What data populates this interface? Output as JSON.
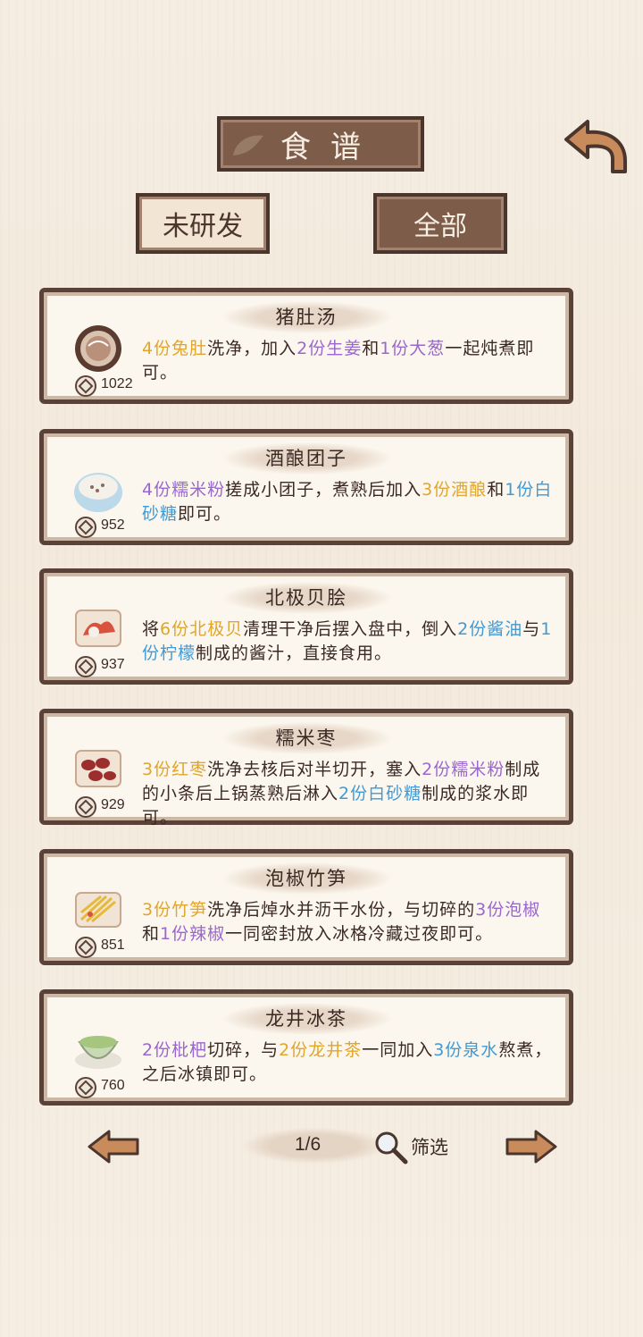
{
  "header": {
    "title": "食谱"
  },
  "tabs": [
    {
      "label": "未研发"
    },
    {
      "label": "全部"
    }
  ],
  "colors": {
    "gold": "#e0a52a",
    "purple": "#9a66cf",
    "blue": "#3f9ad6",
    "text": "#3b2a24",
    "frame": "#5a4239"
  },
  "recipes": [
    {
      "name": "猪肚汤",
      "price": "1022",
      "icon": "pot-soup-icon",
      "desc": [
        {
          "t": "4份兔肚",
          "c": "gold"
        },
        {
          "t": "洗净，加入"
        },
        {
          "t": "2份生姜",
          "c": "purple"
        },
        {
          "t": "和"
        },
        {
          "t": "1份大葱",
          "c": "purple"
        },
        {
          "t": "一起炖煮即可。"
        }
      ]
    },
    {
      "name": "酒酿团子",
      "price": "952",
      "icon": "rice-bowl-icon",
      "desc": [
        {
          "t": "4份糯米粉",
          "c": "purple"
        },
        {
          "t": "搓成小团子，煮熟后加入"
        },
        {
          "t": "3份酒酿",
          "c": "gold"
        },
        {
          "t": "和"
        },
        {
          "t": "1份白砂糖",
          "c": "blue"
        },
        {
          "t": "即可。"
        }
      ]
    },
    {
      "name": "北极贝脍",
      "price": "937",
      "icon": "shellfish-plate-icon",
      "desc": [
        {
          "t": "将"
        },
        {
          "t": "6份北极贝",
          "c": "gold"
        },
        {
          "t": "清理干净后摆入盘中，倒入"
        },
        {
          "t": "2份酱油",
          "c": "blue"
        },
        {
          "t": "与"
        },
        {
          "t": "1份柠檬",
          "c": "blue"
        },
        {
          "t": "制成的酱汁，直接食用。"
        }
      ]
    },
    {
      "name": "糯米枣",
      "price": "929",
      "icon": "dates-plate-icon",
      "desc": [
        {
          "t": "3份红枣",
          "c": "gold"
        },
        {
          "t": "洗净去核后对半切开，塞入"
        },
        {
          "t": "2份糯米粉",
          "c": "purple"
        },
        {
          "t": "制成的小条后上锅蒸熟后淋入"
        },
        {
          "t": "2份白砂糖",
          "c": "blue"
        },
        {
          "t": "制成的浆水即可。"
        }
      ]
    },
    {
      "name": "泡椒竹笋",
      "price": "851",
      "icon": "bamboo-shoots-icon",
      "desc": [
        {
          "t": "3份竹笋",
          "c": "gold"
        },
        {
          "t": "洗净后焯水并沥干水份，与切碎的"
        },
        {
          "t": "3份泡椒",
          "c": "purple"
        },
        {
          "t": "和"
        },
        {
          "t": "1份辣椒",
          "c": "purple"
        },
        {
          "t": "一同密封放入冰格冷藏过夜即可。"
        }
      ]
    },
    {
      "name": "龙井冰茶",
      "price": "760",
      "icon": "tea-cup-icon",
      "desc": [
        {
          "t": "2份枇杷",
          "c": "purple"
        },
        {
          "t": "切碎，与"
        },
        {
          "t": "2份龙井茶",
          "c": "gold"
        },
        {
          "t": "一同加入"
        },
        {
          "t": "3份泉水",
          "c": "blue"
        },
        {
          "t": "熬煮，之后冰镇即可。"
        }
      ]
    }
  ],
  "pager": {
    "page": "1/6",
    "filter_label": "筛选"
  }
}
